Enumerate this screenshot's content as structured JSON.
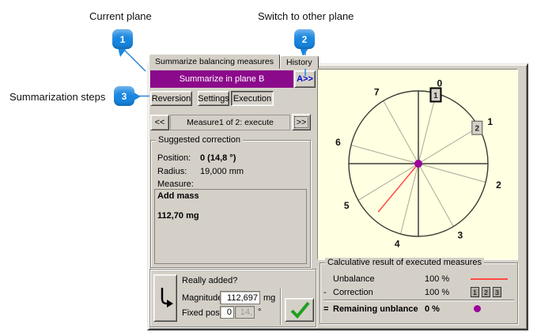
{
  "annotations": {
    "current_plane": "Current plane",
    "switch_plane": "Switch to other plane",
    "summarization_steps": "Summarization steps",
    "callouts": [
      "1",
      "2",
      "3"
    ]
  },
  "colors": {
    "banner_purple": "#8b0a8b",
    "switch_link_blue": "#0000cc",
    "callout_blue": "#1886e0",
    "confirm_green": "#1fa01f"
  },
  "window": {
    "tabs": [
      {
        "label": "Summarize balancing measures",
        "active": true
      },
      {
        "label": "History",
        "active": false
      }
    ],
    "plane_banner": {
      "label": "Summarize in plane B",
      "switch_button": "A>>"
    },
    "steps": [
      {
        "label": "Reversion"
      },
      {
        "label": "Settings"
      },
      {
        "label": "Execution",
        "active": true
      }
    ],
    "nav": {
      "prev": "<<",
      "label": "Measure1 of 2: execute",
      "next": ">>"
    },
    "suggested_correction": {
      "title": "Suggested correction",
      "position_label": "Position:",
      "position_value": "0 (14,8 °)",
      "radius_label": "Radius:",
      "radius_value": "19,000 mm",
      "measure_label": "Measure:",
      "measure_lines": [
        "Add mass",
        "112,70 mg"
      ]
    },
    "really_added": {
      "question": "Really added?",
      "magnitude_label": "Magnitude",
      "magnitude_value": "112,697",
      "magnitude_unit": "mg",
      "fixed_label": "Fixed positio",
      "fixed_value": "0",
      "fixed_value_secondary": "14,",
      "fixed_unit": "°"
    },
    "calc_result": {
      "title": "Calculative result of executed measures",
      "rows": [
        {
          "prefix": "",
          "label": "Unbalance",
          "value": "100 %"
        },
        {
          "prefix": "-",
          "label": "Correction",
          "value": "100 %",
          "boxes": [
            "1",
            "2",
            "3"
          ]
        },
        {
          "prefix": "=",
          "label": "Remaining unblance",
          "value": "0 %"
        }
      ]
    }
  },
  "chart_data": {
    "type": "polar-positions",
    "position_labels": [
      "0",
      "1",
      "2",
      "3",
      "4",
      "5",
      "6",
      "7"
    ],
    "rotation_deg": 14.8,
    "position_step_deg": 45,
    "markers": [
      {
        "label": "1",
        "position": 0,
        "selected": true
      },
      {
        "label": "2",
        "position": 1,
        "selected": false
      }
    ],
    "unbalance_vector": {
      "angle_deg": 221,
      "magnitude_ratio": 0.88
    },
    "colors": {
      "background": "#ffffe1",
      "unbalance_line": "#ff4a42",
      "center_dot": "#9c009c",
      "axis_dark": "#6e6e64",
      "spoke_light": "#a9a99c",
      "outline": "#3b3b32"
    }
  }
}
